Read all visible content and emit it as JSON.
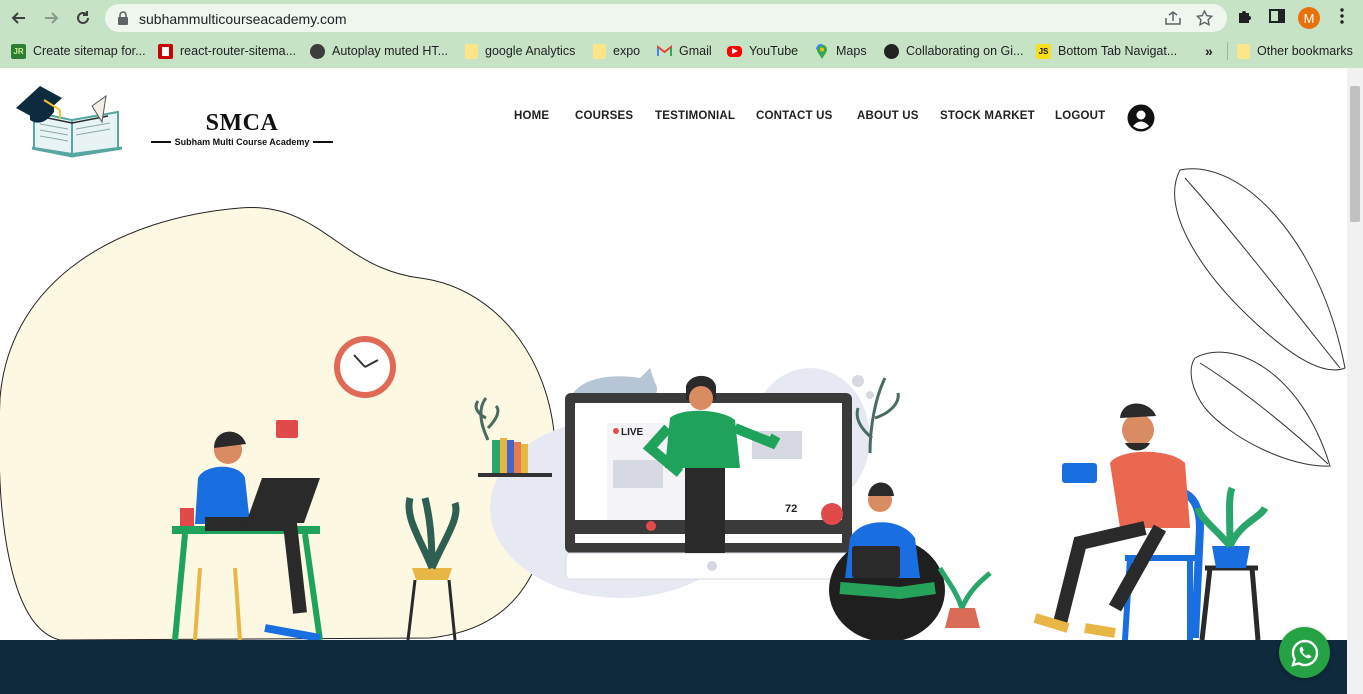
{
  "browser": {
    "url": "subhammulticourseacademy.com",
    "profile_initial": "M",
    "bookmarks": [
      {
        "label": "Create sitemap for...",
        "icon": "xml-sitemaps-favicon"
      },
      {
        "label": "react-router-sitema...",
        "icon": "npm-favicon"
      },
      {
        "label": "Autoplay muted HT...",
        "icon": "globe-favicon"
      },
      {
        "label": "google Analytics",
        "icon": "folder-icon"
      },
      {
        "label": "expo",
        "icon": "folder-icon"
      },
      {
        "label": "Gmail",
        "icon": "gmail-favicon"
      },
      {
        "label": "YouTube",
        "icon": "youtube-favicon"
      },
      {
        "label": "Maps",
        "icon": "maps-favicon"
      },
      {
        "label": "Collaborating on Gi...",
        "icon": "github-favicon"
      },
      {
        "label": "Bottom Tab Navigat...",
        "icon": "js-favicon"
      }
    ],
    "overflow_label": "»",
    "other_bookmarks": "Other bookmarks"
  },
  "site": {
    "brand_title": "SMCA",
    "brand_subtitle": "Subham Multi Course Academy",
    "menu": [
      "HOME",
      "COURSES",
      "TESTIMONIAL",
      "CONTACT US",
      "ABOUT US",
      "STOCK MARKET",
      "LOGOUT"
    ],
    "hero_live_label": "LIVE",
    "hero_viewer_count": "72"
  },
  "colors": {
    "chrome": "#c7e3c5",
    "footer": "#0f2a3d",
    "whatsapp": "#25a244",
    "accent_green": "#1fa35a",
    "accent_blue": "#1a6fe0"
  }
}
